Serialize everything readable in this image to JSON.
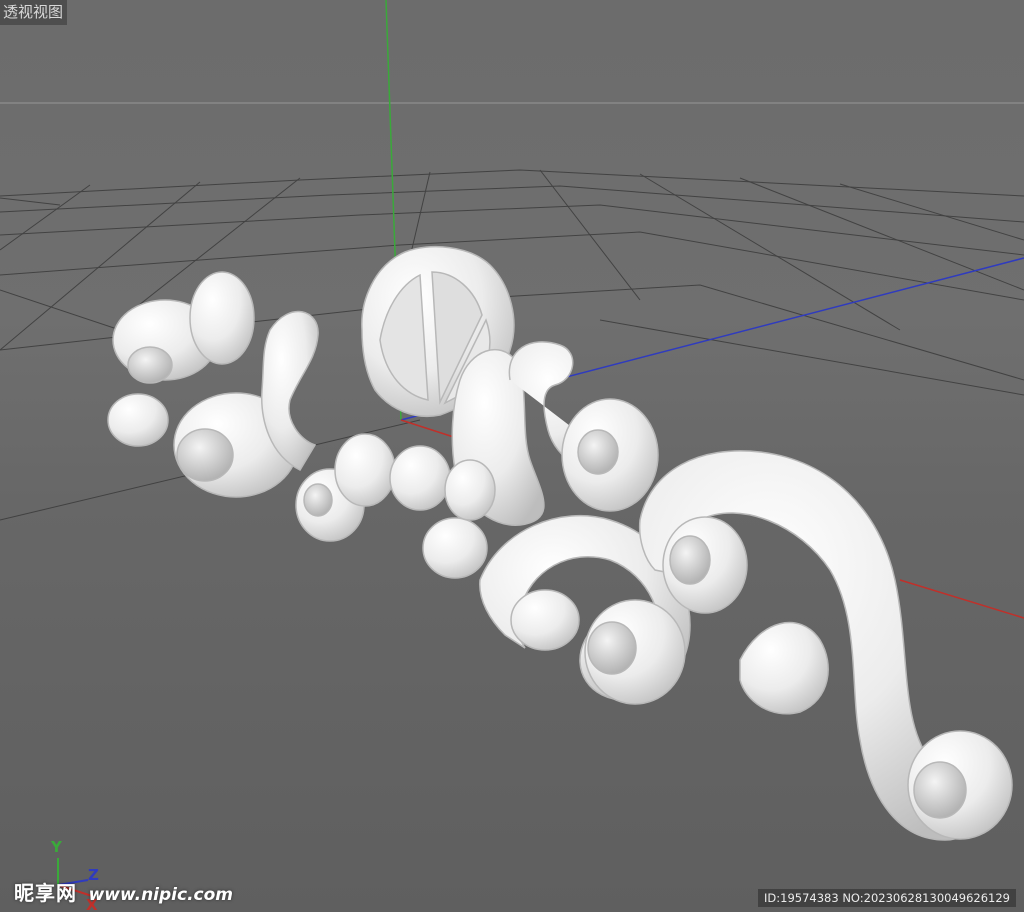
{
  "viewport": {
    "view_label": "透视视图",
    "background_color": "#6b6b6b",
    "grid_color": "#3a3a3a",
    "axis_colors": {
      "x": "#c0302a",
      "y": "#3aa93a",
      "z": "#2f3bbf"
    },
    "model_color": "#f2f2f2"
  },
  "axis_gizmo": {
    "y_label": "Y",
    "z_label": "Z",
    "x_label": "X"
  },
  "watermark": {
    "logo_text": "昵享网",
    "url": "www.nipic.com"
  },
  "image_id": "ID:19574383 NO:20230628130049626129"
}
